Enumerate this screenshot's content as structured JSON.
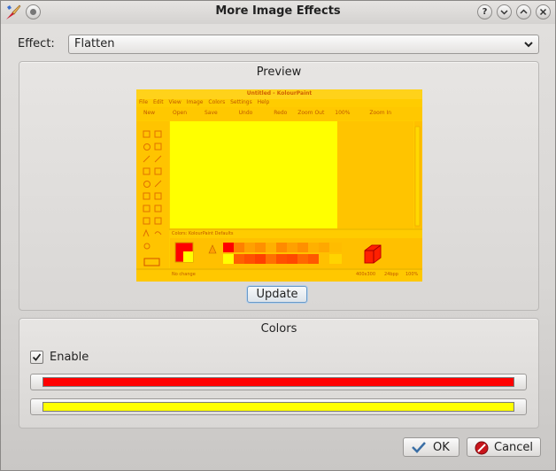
{
  "window": {
    "title": "More Image Effects",
    "buttons": {
      "help": "?",
      "minimize": "⌄",
      "maximize": "⌃",
      "close": "✕"
    }
  },
  "effect": {
    "label": "Effect:",
    "value": "Flatten"
  },
  "preview": {
    "group_title": "Preview",
    "update_label": "Update",
    "thumb": {
      "title": "Untitled - KolourPaint",
      "menu": [
        "File",
        "Edit",
        "View",
        "Image",
        "Colors",
        "Settings",
        "Help"
      ],
      "toolbar": [
        "New",
        "Open",
        "Save",
        "Undo",
        "Redo",
        "Zoom Out",
        "100%",
        "Zoom In"
      ],
      "colors_label": "Colors: KolourPaint Defaults",
      "status_left": "No change",
      "status_size": "400x300",
      "status_depth": "24bpp",
      "status_zoom": "100%"
    }
  },
  "colors": {
    "group_title": "Colors",
    "enable_label": "Enable",
    "enabled": true,
    "color1": "#ff0000",
    "color2": "#ffff00"
  },
  "buttons": {
    "ok": "OK",
    "cancel": "Cancel"
  }
}
